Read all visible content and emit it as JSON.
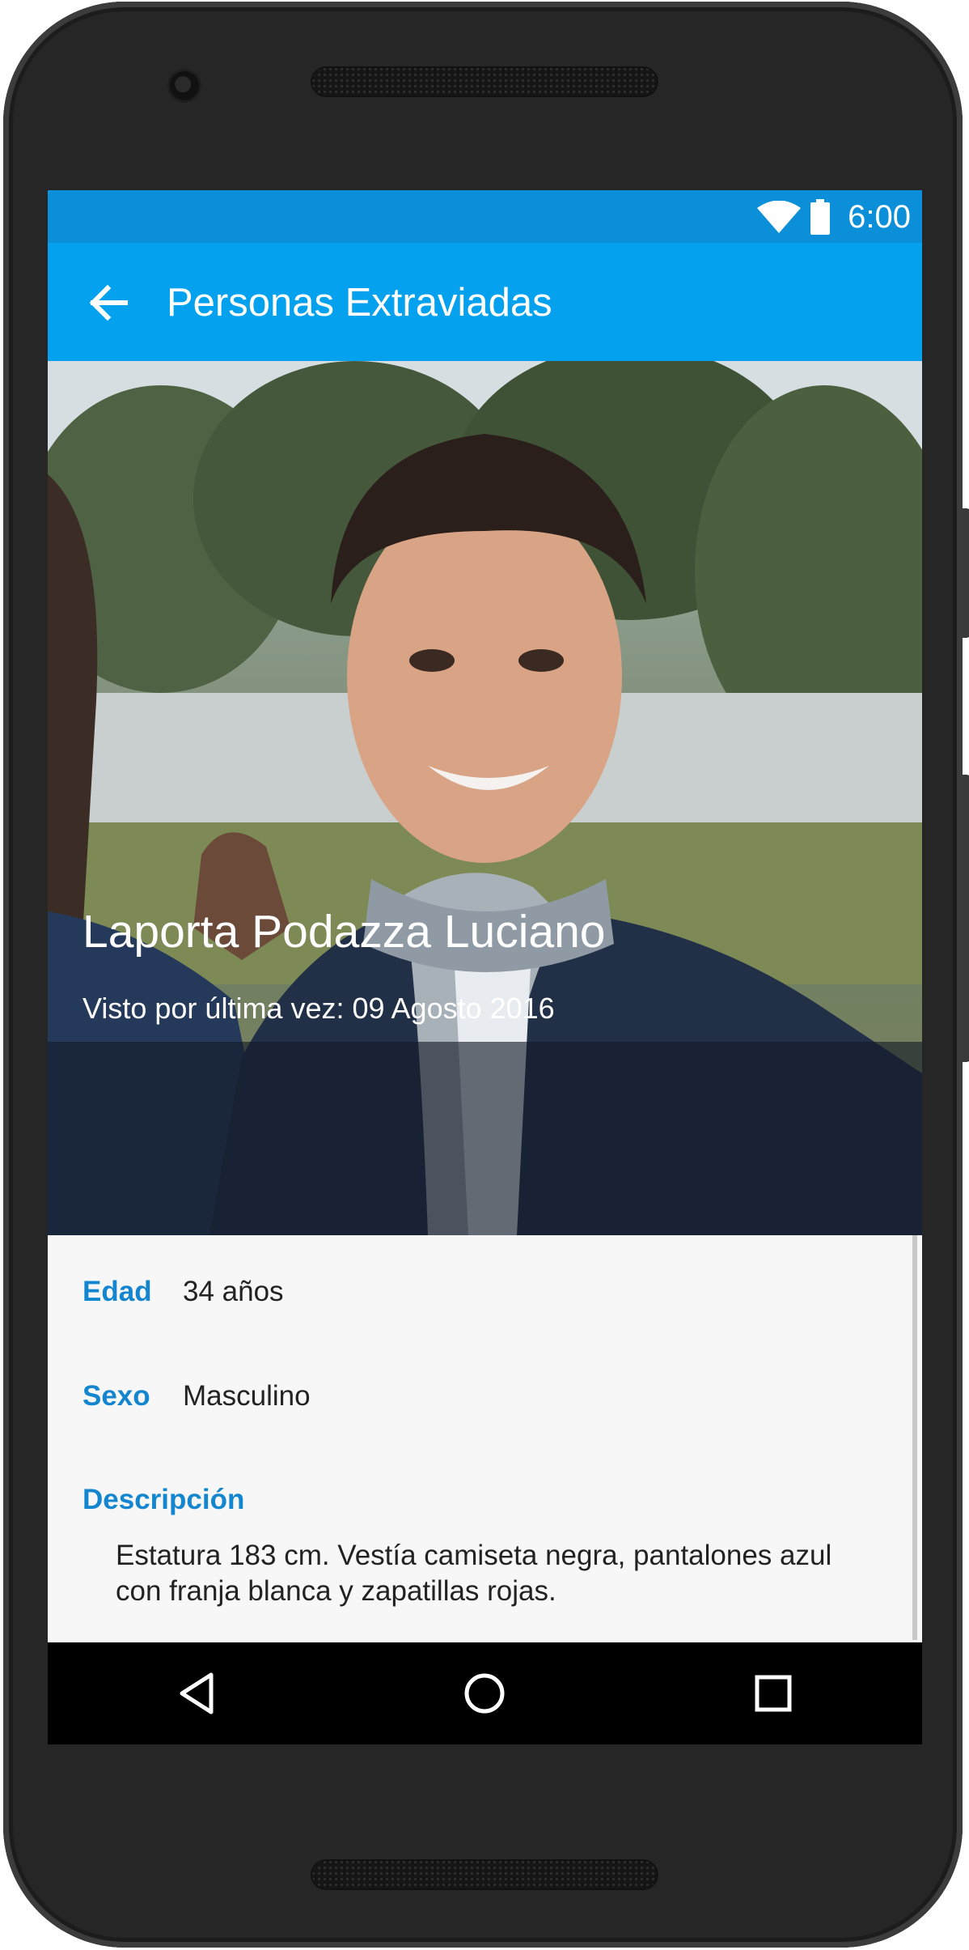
{
  "status_bar": {
    "time": "6:00",
    "icons": [
      "wifi-icon",
      "battery-icon"
    ]
  },
  "app_bar": {
    "title": "Personas Extraviadas",
    "back_icon": "arrow-back-icon"
  },
  "person": {
    "name": "Laporta Podazza Luciano",
    "last_seen": "Visto por última vez: 09 Agosto 2016"
  },
  "details": {
    "age_label": "Edad",
    "age_value": "34 años",
    "sex_label": "Sexo",
    "sex_value": "Masculino",
    "description_label": "Descripción",
    "description_text": "Estatura 183 cm. Vestía camiseta negra, pantalones azul con franja blanca y zapatillas rojas."
  },
  "nav_bar": {
    "icons": [
      "back-triangle-icon",
      "home-circle-icon",
      "recents-square-icon"
    ]
  },
  "colors": {
    "status_bar": "#0b8fd8",
    "app_bar": "#04a1ee",
    "label_accent": "#1386cf",
    "overlay": "#141a28"
  }
}
